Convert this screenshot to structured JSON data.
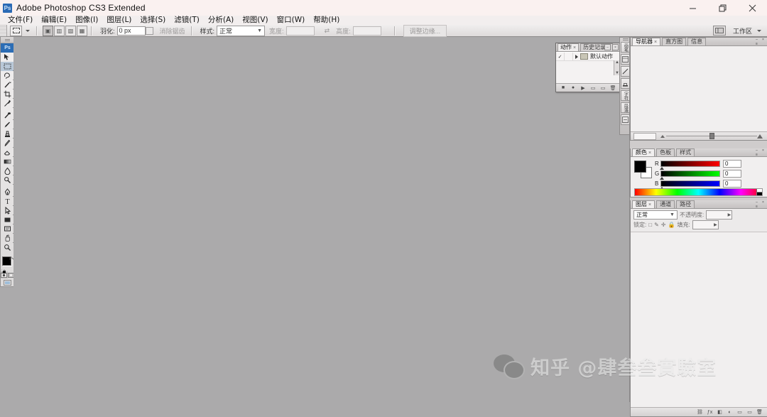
{
  "window": {
    "title": "Adobe Photoshop CS3 Extended",
    "app_icon": "Ps",
    "minimize": "minimize-icon",
    "restore": "restore-icon",
    "close": "close-icon"
  },
  "menubar": {
    "items": [
      {
        "label": "文件(F)",
        "name": "menu-file"
      },
      {
        "label": "编辑(E)",
        "name": "menu-edit"
      },
      {
        "label": "图像(I)",
        "name": "menu-image"
      },
      {
        "label": "图层(L)",
        "name": "menu-layer"
      },
      {
        "label": "选择(S)",
        "name": "menu-select"
      },
      {
        "label": "滤镜(T)",
        "name": "menu-filter"
      },
      {
        "label": "分析(A)",
        "name": "menu-analysis"
      },
      {
        "label": "视图(V)",
        "name": "menu-view"
      },
      {
        "label": "窗口(W)",
        "name": "menu-window"
      },
      {
        "label": "帮助(H)",
        "name": "menu-help"
      }
    ]
  },
  "options_bar": {
    "tool_preset_label": "矩形选框工具",
    "feather_label": "羽化:",
    "feather_value": "0 px",
    "antialias_label": "消除锯齿",
    "style_label": "样式:",
    "style_value": "正常",
    "width_label": "宽度:",
    "height_label": "高度:",
    "refine_edge_label": "调整边缘...",
    "workspace_label": "工作区",
    "workspace_icon": "workspace-icon"
  },
  "toolbox": {
    "logo": "Ps",
    "tools": [
      {
        "name": "move-tool",
        "label": "移动工具"
      },
      {
        "name": "rectangular-marquee-tool",
        "label": "矩形选框工具",
        "active": true
      },
      {
        "name": "lasso-tool",
        "label": "套索工具"
      },
      {
        "name": "magic-wand-tool",
        "label": "魔棒工具"
      },
      {
        "name": "crop-tool",
        "label": "裁剪工具"
      },
      {
        "name": "eyedropper-tool",
        "label": "吸管工具"
      },
      {
        "name": "healing-brush-tool",
        "label": "修复画笔工具"
      },
      {
        "name": "brush-tool",
        "label": "画笔工具"
      },
      {
        "name": "clone-stamp-tool",
        "label": "仿制图章工具"
      },
      {
        "name": "history-brush-tool",
        "label": "历史记录画笔工具"
      },
      {
        "name": "eraser-tool",
        "label": "橡皮擦工具"
      },
      {
        "name": "gradient-tool",
        "label": "渐变工具"
      },
      {
        "name": "blur-tool",
        "label": "模糊工具"
      },
      {
        "name": "dodge-tool",
        "label": "减淡工具"
      },
      {
        "name": "pen-tool",
        "label": "钢笔工具"
      },
      {
        "name": "type-tool",
        "label": "横排文字工具"
      },
      {
        "name": "path-selection-tool",
        "label": "路径选择工具"
      },
      {
        "name": "rectangle-tool",
        "label": "矩形工具"
      },
      {
        "name": "notes-tool",
        "label": "注释工具"
      },
      {
        "name": "hand-tool",
        "label": "抓手工具"
      },
      {
        "name": "zoom-tool",
        "label": "缩放工具"
      }
    ],
    "foreground_color": "#000000",
    "background_color": "#ffffff",
    "quickmask_standard": "standard-mode-icon",
    "quickmask_mask": "quick-mask-icon",
    "screen_mode": "screen-mode-icon"
  },
  "actions_palette": {
    "tabs": [
      {
        "label": "动作",
        "active": true,
        "name": "tab-actions"
      },
      {
        "label": "历史记录",
        "active": false,
        "name": "tab-history"
      }
    ],
    "row": {
      "toggle": "✓",
      "name": "默认动作"
    },
    "footer_buttons": [
      {
        "name": "stop-button",
        "glyph": "■"
      },
      {
        "name": "record-button",
        "glyph": "●"
      },
      {
        "name": "play-button",
        "glyph": "▶"
      },
      {
        "name": "new-set-button",
        "glyph": "▭"
      },
      {
        "name": "new-action-button",
        "glyph": "▭"
      },
      {
        "name": "delete-button",
        "glyph": "🗑"
      }
    ]
  },
  "dock_strip": {
    "buttons": [
      {
        "label": "画笔",
        "name": "dock-icon-brushes"
      },
      {
        "label": "图层复合",
        "name": "dock-icon-layer-comps"
      },
      {
        "label": "工具预设",
        "name": "dock-icon-tool-presets"
      },
      {
        "label": "仿制源",
        "name": "dock-icon-clone-source"
      },
      {
        "label": "字符",
        "name": "dock-icon-character"
      },
      {
        "label": "段落",
        "name": "dock-icon-paragraph"
      },
      {
        "label": "信息",
        "name": "dock-icon-info"
      }
    ]
  },
  "navigator_panel": {
    "tabs": [
      {
        "label": "导航器",
        "active": true,
        "name": "tab-navigator"
      },
      {
        "label": "直方图",
        "active": false,
        "name": "tab-histogram"
      },
      {
        "label": "信息",
        "active": false,
        "name": "tab-info"
      }
    ],
    "zoom_value": ""
  },
  "color_panel": {
    "tabs": [
      {
        "label": "颜色",
        "active": true,
        "name": "tab-color"
      },
      {
        "label": "色板",
        "active": false,
        "name": "tab-swatches"
      },
      {
        "label": "样式",
        "active": false,
        "name": "tab-styles"
      }
    ],
    "foreground_color": "#000000",
    "background_color": "#ffffff",
    "channels": [
      {
        "label": "R",
        "value": "0"
      },
      {
        "label": "G",
        "value": "0"
      },
      {
        "label": "B",
        "value": "0"
      }
    ]
  },
  "layers_panel": {
    "tabs": [
      {
        "label": "图层",
        "active": true,
        "name": "tab-layers"
      },
      {
        "label": "通道",
        "active": false,
        "name": "tab-channels"
      },
      {
        "label": "路径",
        "active": false,
        "name": "tab-paths"
      }
    ],
    "blend_mode": "正常",
    "opacity_label": "不透明度:",
    "opacity_value": "",
    "lock_label": "锁定:",
    "fill_label": "填充:",
    "fill_value": "",
    "lock_icons": [
      "□",
      "✎",
      "✛",
      "🔒"
    ],
    "footer_buttons": [
      {
        "name": "link-layers-button",
        "glyph": "⛓"
      },
      {
        "name": "layer-style-button",
        "glyph": "ƒx"
      },
      {
        "name": "layer-mask-button",
        "glyph": "◧"
      },
      {
        "name": "adjustment-layer-button",
        "glyph": "◐"
      },
      {
        "name": "new-group-button",
        "glyph": "▭"
      },
      {
        "name": "new-layer-button",
        "glyph": "▭"
      },
      {
        "name": "delete-layer-button",
        "glyph": "🗑"
      }
    ]
  },
  "watermark": {
    "text": "知乎 @肆叁叁實驗室",
    "icon": "wechat-icon"
  },
  "canvas": {
    "background_color": "#abaaab"
  }
}
